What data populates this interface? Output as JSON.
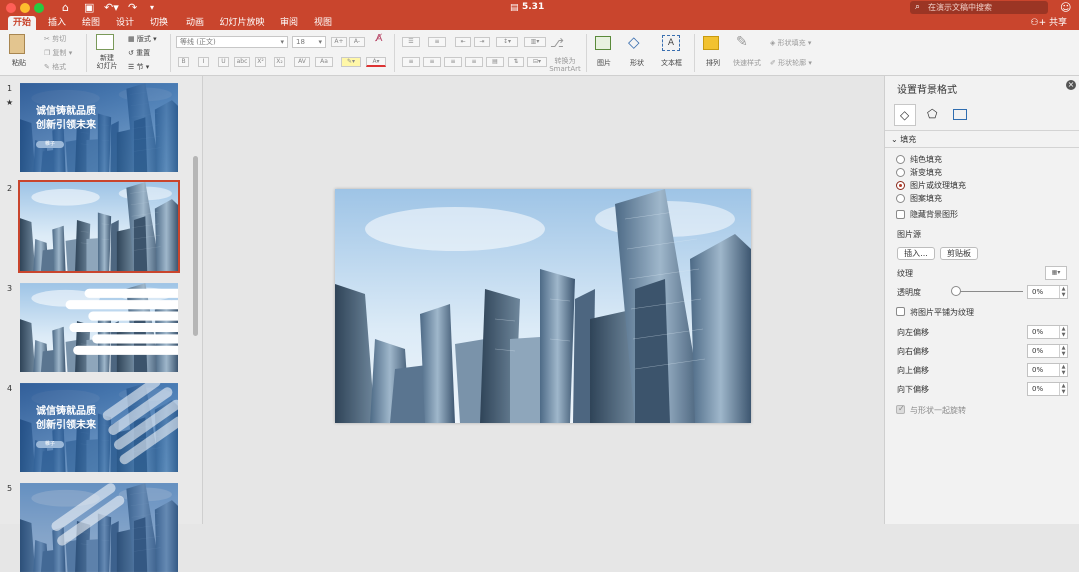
{
  "window": {
    "title": "5.31",
    "search_placeholder": "在演示文稿中搜索"
  },
  "tabs": [
    "开始",
    "插入",
    "绘图",
    "设计",
    "切换",
    "动画",
    "幻灯片放映",
    "审阅",
    "视图"
  ],
  "active_tab": "开始",
  "share_label": "共享",
  "ribbon": {
    "paste": "粘贴",
    "cut": "剪切",
    "copy": "复制",
    "format": "格式",
    "new_slide": "新建\n幻灯片",
    "layout": "版式",
    "reset": "重置",
    "section": "节",
    "font_name": "等线 (正文)",
    "font_size": "18",
    "convert_smartart": "转换为\nSmartArt",
    "picture": "图片",
    "shapes": "形状",
    "textbox": "文本框",
    "arrange": "排列",
    "quick_styles": "快速样式",
    "shape_fill": "形状填充",
    "shape_outline": "形状轮廓"
  },
  "slides": [
    {
      "num": "1",
      "marker": "★",
      "title_line1": "诚信铸就品质",
      "title_line2": "创新引领未来",
      "button": "帷子"
    },
    {
      "num": "2"
    },
    {
      "num": "3"
    },
    {
      "num": "4",
      "title_line1": "诚信铸就品质",
      "title_line2": "创新引领未来",
      "button": "帷子"
    },
    {
      "num": "5"
    }
  ],
  "pane": {
    "title": "设置背景格式",
    "section_fill": "填充",
    "options": [
      "纯色填充",
      "渐变填充",
      "图片或纹理填充",
      "图案填充"
    ],
    "selected_option": "图片或纹理填充",
    "hide_bg_graphics": "隐藏背景图形",
    "picture_source": "图片源",
    "insert_button": "插入...",
    "clipboard_button": "剪贴板",
    "texture": "纹理",
    "transparency": "透明度",
    "transparency_value": "0%",
    "tile_as_texture": "将图片平铺为纹理",
    "offset_left": "向左偏移",
    "offset_right": "向右偏移",
    "offset_up": "向上偏移",
    "offset_down": "向下偏移",
    "offset_left_value": "0%",
    "offset_right_value": "0%",
    "offset_up_value": "0%",
    "offset_down_value": "0%",
    "rotate_with_shape": "与形状一起旋转"
  },
  "colors": {
    "accent": "#c9452d",
    "dark_accent": "#9b3524"
  }
}
